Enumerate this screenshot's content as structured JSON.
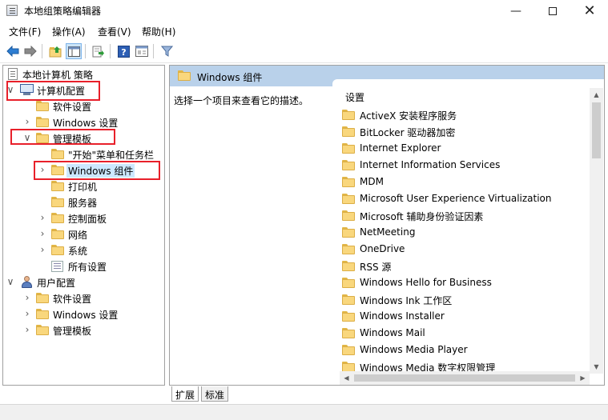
{
  "window": {
    "title": "本地组策略编辑器",
    "controls": {
      "minimize": "—",
      "close": "✕"
    }
  },
  "menu": [
    "文件(F)",
    "操作(A)",
    "查看(V)",
    "帮助(H)"
  ],
  "toolbar_icons": [
    "back-arrow-icon",
    "forward-arrow-icon",
    "up-folder-icon",
    "show-hide-tree-icon",
    "export-list-icon",
    "help-icon",
    "properties-icon",
    "filter-icon"
  ],
  "tree": {
    "root": "本地计算机 策略",
    "computer_config": "计算机配置",
    "computer_children": [
      "软件设置",
      "Windows 设置",
      "管理模板"
    ],
    "admin_templates_children": [
      "\"开始\"菜单和任务栏",
      "Windows 组件",
      "打印机",
      "服务器",
      "控制面板",
      "网络",
      "系统",
      "所有设置"
    ],
    "user_config": "用户配置",
    "user_children": [
      "软件设置",
      "Windows 设置",
      "管理模板"
    ],
    "expander_collapsed": "›",
    "expander_expanded": "∨"
  },
  "right_pane": {
    "header": "Windows 组件",
    "description": "选择一个项目来查看它的描述。",
    "column_header": "设置",
    "items": [
      "ActiveX 安装程序服务",
      "BitLocker 驱动器加密",
      "Internet Explorer",
      "Internet Information Services",
      "MDM",
      "Microsoft User Experience Virtualization",
      "Microsoft 辅助身份验证因素",
      "NetMeeting",
      "OneDrive",
      "RSS 源",
      "Windows Hello for Business",
      "Windows Ink 工作区",
      "Windows Installer",
      "Windows Mail",
      "Windows Media Player",
      "Windows Media 数字权限管理"
    ]
  },
  "scroll": {
    "up": "▲",
    "down": "▼",
    "left": "◀",
    "right": "▶"
  },
  "tabs": [
    "扩展",
    "标准"
  ],
  "colors": {
    "highlight_box": "#e8202a",
    "header_bg": "#b9d1ea",
    "folder": "#f9d77d"
  }
}
